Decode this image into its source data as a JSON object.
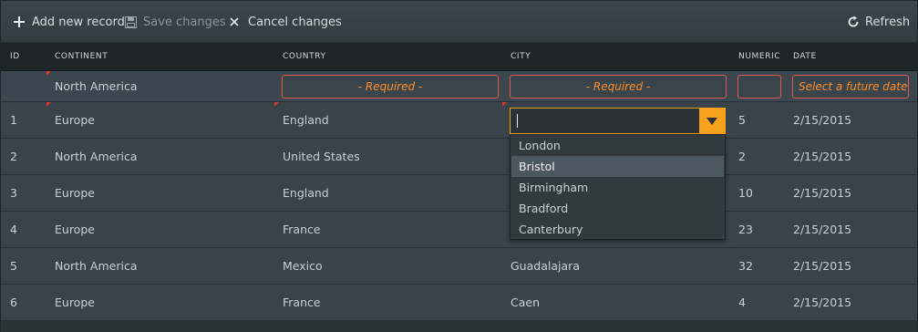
{
  "toolbar": {
    "add_label": "Add new record",
    "save_label": "Save changes",
    "cancel_label": "Cancel changes",
    "refresh_label": "Refresh"
  },
  "columns": [
    "ID",
    "CONTINENT",
    "COUNTRY",
    "CITY",
    "NUMERIC",
    "DATE"
  ],
  "new_row": {
    "continent": "North America",
    "country_placeholder": "- Required -",
    "city_placeholder": "- Required -",
    "date_placeholder": "Select a future date"
  },
  "rows": [
    {
      "id": "1",
      "continent": "Europe",
      "country": "England",
      "city": "",
      "numeric": "5",
      "date": "2/15/2015"
    },
    {
      "id": "2",
      "continent": "North America",
      "country": "United States",
      "city": "",
      "numeric": "2",
      "date": "2/15/2015"
    },
    {
      "id": "3",
      "continent": "Europe",
      "country": "England",
      "city": "",
      "numeric": "10",
      "date": "2/15/2015"
    },
    {
      "id": "4",
      "continent": "Europe",
      "country": "France",
      "city": "",
      "numeric": "23",
      "date": "2/15/2015"
    },
    {
      "id": "5",
      "continent": "North America",
      "country": "Mexico",
      "city": "Guadalajara",
      "numeric": "32",
      "date": "2/15/2015"
    },
    {
      "id": "6",
      "continent": "Europe",
      "country": "France",
      "city": "Caen",
      "numeric": "4",
      "date": "2/15/2015"
    }
  ],
  "city_dropdown": {
    "options": [
      "London",
      "Bristol",
      "Birmingham",
      "Bradford",
      "Canterbury"
    ],
    "selected": "Bristol"
  },
  "colors": {
    "accent": "#f7a11a",
    "dirty_marker": "#e0342a",
    "required_border": "#e0584f",
    "required_text": "#ff8c2a"
  }
}
